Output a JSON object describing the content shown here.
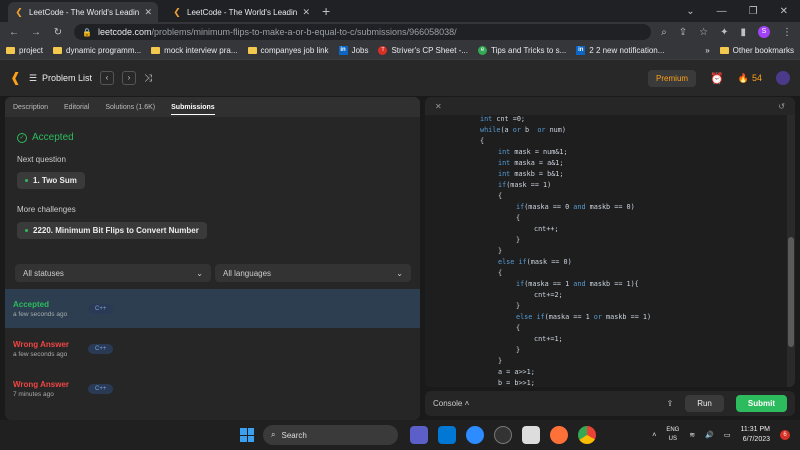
{
  "browser": {
    "tabs": [
      {
        "title": "LeetCode - The World's Leading",
        "active": true
      },
      {
        "title": "LeetCode - The World's Leading",
        "active": false
      }
    ],
    "url_host": "leetcode.com",
    "url_path": "/problems/minimum-flips-to-make-a-or-b-equal-to-c/submissions/966058038/",
    "profile_letter": "S"
  },
  "bookmarks": [
    {
      "label": "project",
      "icon": "folder"
    },
    {
      "label": "dynamic programm...",
      "icon": "folder"
    },
    {
      "label": "mock interview pra...",
      "icon": "folder"
    },
    {
      "label": "companyes job link",
      "icon": "folder"
    },
    {
      "label": "Jobs",
      "icon": "linkedin"
    },
    {
      "label": "Striver's CP Sheet -...",
      "icon": "tuf"
    },
    {
      "label": "Tips and Tricks to s...",
      "icon": "green"
    },
    {
      "label": "2 2 new notification...",
      "icon": "linkedin"
    },
    {
      "label": "Other bookmarks",
      "icon": "folder"
    }
  ],
  "lcnav": {
    "problem_list": "Problem List",
    "premium": "Premium",
    "streak": "54"
  },
  "left": {
    "tabs": [
      "Description",
      "Editorial",
      "Solutions (1.6K)",
      "Submissions"
    ],
    "active_tab": "Submissions",
    "result": "Accepted",
    "next_question_label": "Next question",
    "next_question": "1. Two Sum",
    "more_challenges_label": "More challenges",
    "more_challenge": "2220. Minimum Bit Flips to Convert Number",
    "filter_status": "All statuses",
    "filter_lang": "All languages",
    "submissions": [
      {
        "status": "Accepted",
        "time": "a few seconds ago",
        "lang": "C++",
        "color": "#2cbb5d"
      },
      {
        "status": "Wrong Answer",
        "time": "a few seconds ago",
        "lang": "C++",
        "color": "#ef4743"
      },
      {
        "status": "Wrong Answer",
        "time": "7 minutes ago",
        "lang": "C++",
        "color": "#ef4743"
      }
    ]
  },
  "code_lines": [
    {
      "indent": 0,
      "text": "int cnt =0;"
    },
    {
      "indent": 0,
      "text": "while(a or b  or num)"
    },
    {
      "indent": 0,
      "text": "{"
    },
    {
      "indent": 1,
      "text": "int mask = num&1;"
    },
    {
      "indent": 1,
      "text": "int maska = a&1;"
    },
    {
      "indent": 1,
      "text": "int maskb = b&1;"
    },
    {
      "indent": 1,
      "text": "if(mask == 1)"
    },
    {
      "indent": 1,
      "text": "{"
    },
    {
      "indent": 2,
      "text": "if(maska == 0 and maskb == 0)"
    },
    {
      "indent": 2,
      "text": "{"
    },
    {
      "indent": 3,
      "text": "cnt++;"
    },
    {
      "indent": 2,
      "text": "}"
    },
    {
      "indent": 1,
      "text": "}"
    },
    {
      "indent": 1,
      "text": "else if(mask == 0)"
    },
    {
      "indent": 1,
      "text": "{"
    },
    {
      "indent": 2,
      "text": "if(maska == 1 and maskb == 1){"
    },
    {
      "indent": 3,
      "text": "cnt+=2;"
    },
    {
      "indent": 2,
      "text": "}"
    },
    {
      "indent": 2,
      "text": "else if(maska == 1 or maskb == 1)"
    },
    {
      "indent": 2,
      "text": "{"
    },
    {
      "indent": 3,
      "text": "cnt+=1;"
    },
    {
      "indent": 2,
      "text": "}"
    },
    {
      "indent": 1,
      "text": "}"
    },
    {
      "indent": 1,
      "text": "a = a>>1;"
    },
    {
      "indent": 1,
      "text": "b = b>>1;"
    }
  ],
  "console": {
    "label": "Console",
    "run": "Run",
    "submit": "Submit"
  },
  "taskbar": {
    "search": "Search",
    "lang_line1": "ENG",
    "lang_line2": "US",
    "time": "11:31 PM",
    "date": "6/7/2023",
    "notif_count": "6"
  }
}
